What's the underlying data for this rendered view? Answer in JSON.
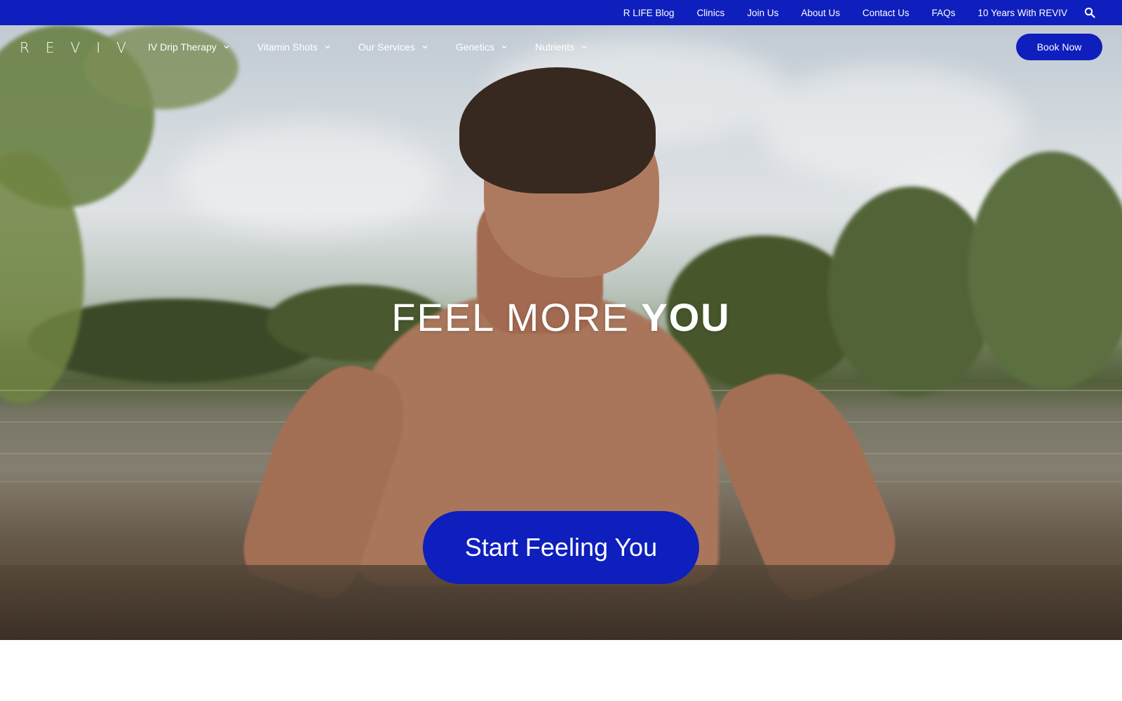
{
  "topbar": {
    "links": [
      "R LIFE Blog",
      "Clinics",
      "Join Us",
      "About Us",
      "Contact Us",
      "FAQs",
      "10 Years With REVIV"
    ],
    "search_icon": "search-icon",
    "background_color": "#0e1fbd"
  },
  "nav": {
    "logo": "REVIV",
    "items": [
      {
        "label": "IV Drip Therapy",
        "icon": "chevron-down-icon"
      },
      {
        "label": "Vitamin Shots",
        "icon": "chevron-down-icon"
      },
      {
        "label": "Our Services",
        "icon": "chevron-down-icon"
      },
      {
        "label": "Genetics",
        "icon": "chevron-down-icon"
      },
      {
        "label": "Nutrients",
        "icon": "chevron-down-icon"
      }
    ],
    "book_button": "Book Now"
  },
  "hero": {
    "headline_light": "FEEL MORE",
    "headline_bold": "YOU",
    "cta_label": "Start Feeling You"
  },
  "colors": {
    "brand_blue": "#0e1fbd",
    "text_on_dark": "#ffffff"
  }
}
